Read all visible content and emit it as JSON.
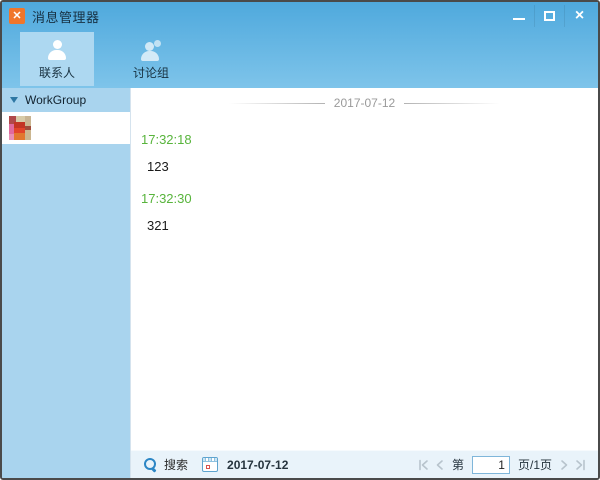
{
  "window": {
    "title": "消息管理器",
    "app_icon_glyph": "✕",
    "controls": {
      "minimize": "minimize-icon",
      "maximize": "maximize-icon",
      "close_glyph": "×"
    }
  },
  "colors": {
    "titlebar_gradient_top": "#4FA9DD",
    "titlebar_gradient_bottom": "#7EC4EA",
    "selected_tab_bg": "#ADD8F1",
    "sidebar_bg": "#A9D4EE",
    "app_icon_orange": "#F0762B",
    "timestamp_green": "#58B43C",
    "bottom_bar_bg": "#E9F3FA",
    "pager_arrow": "#B8C4CD"
  },
  "toolbar": {
    "tabs": [
      {
        "label": "联系人",
        "icon": "person-icon",
        "selected": true
      },
      {
        "label": "讨论组",
        "icon": "group-icon",
        "selected": false
      }
    ]
  },
  "sidebar": {
    "group": {
      "label": "WorkGroup",
      "expanded": true
    },
    "avatar": "contact-avatar"
  },
  "main": {
    "date_header": "2017-07-12",
    "messages": [
      {
        "time": "17:32:18",
        "text": "123"
      },
      {
        "time": "17:32:30",
        "text": "321"
      }
    ]
  },
  "bottom_bar": {
    "search_icon": "magnifier-icon",
    "search_label": "搜索",
    "calendar_icon": "calendar-icon",
    "date_value": "2017-07-12",
    "pagination": {
      "first": "first-page",
      "prev": "previous-page",
      "page_prefix": "第",
      "page_value": "1",
      "page_suffix": "页/1页",
      "next": "next-page",
      "last": "last-page"
    }
  }
}
